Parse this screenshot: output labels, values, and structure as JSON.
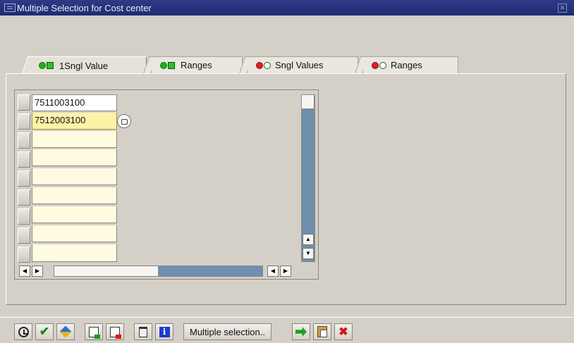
{
  "window": {
    "title": "Multiple Selection for Cost center"
  },
  "tabs": [
    {
      "label": "1Sngl Value",
      "status": "green",
      "active": true
    },
    {
      "label": "Ranges",
      "status": "green",
      "active": false
    },
    {
      "label": "Sngl Values",
      "status": "red",
      "active": false
    },
    {
      "label": "Ranges",
      "status": "red",
      "active": false
    }
  ],
  "table": {
    "rows": [
      "7511003100",
      "7512003100",
      "",
      "",
      "",
      "",
      "",
      "",
      ""
    ],
    "focused_row": 1
  },
  "toolbar": {
    "multiple_selection_label": "Multiple selection..",
    "icons": [
      "execute-icon",
      "check-icon",
      "copy-icon",
      "insert-line-icon",
      "delete-line-icon",
      "delete-all-icon",
      "help-icon",
      "import-icon",
      "paste-icon",
      "cancel-icon"
    ]
  },
  "colors": {
    "titlebar": "#2d3b86",
    "panel": "#d4d0c8",
    "input_bg": "#fffbe0",
    "focus_bg": "#fff2a8"
  }
}
